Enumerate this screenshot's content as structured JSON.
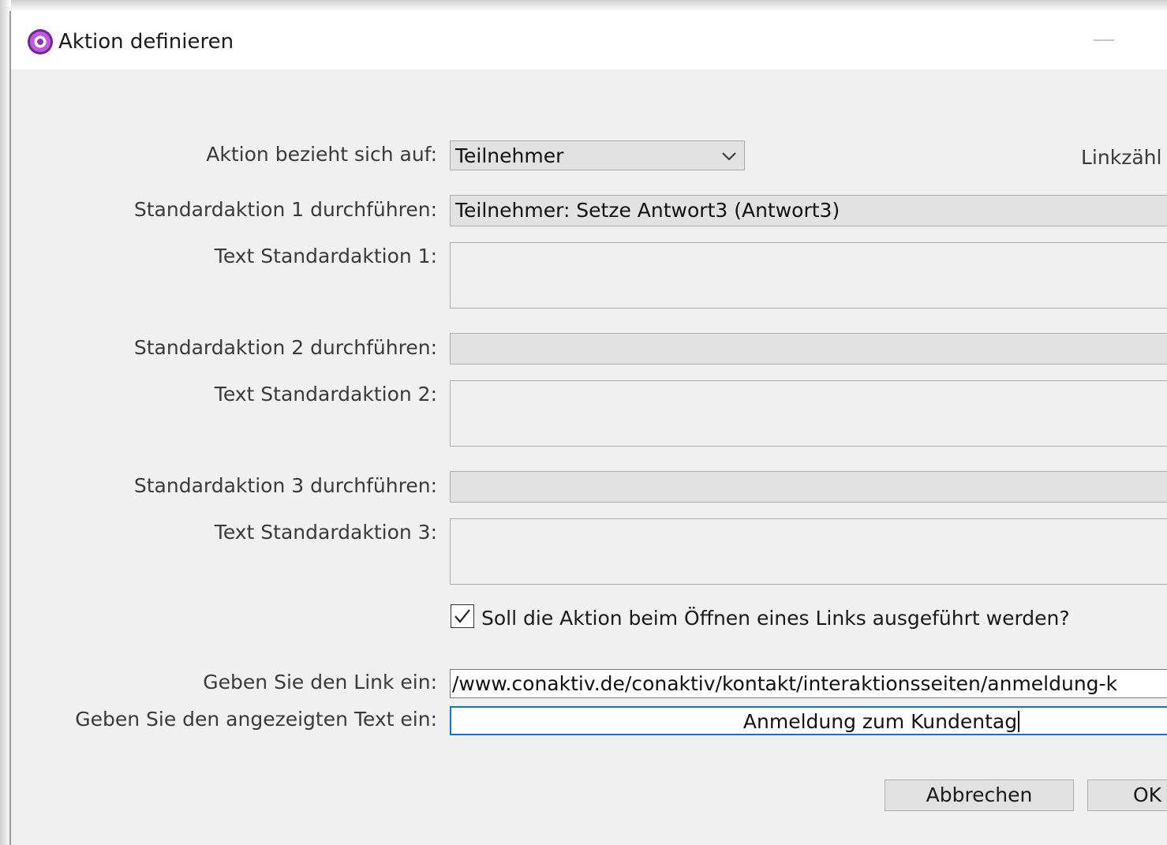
{
  "window": {
    "title": "Aktion definieren",
    "icon": "purple-ring-icon",
    "accent_color": "#0a78d7"
  },
  "form": {
    "relates_to_label": "Aktion bezieht sich auf:",
    "relates_to_value": "Teilnehmer",
    "link_counter_label": "Linkzähl",
    "action1_label": "Standardaktion 1 durchführen:",
    "action1_value": "Teilnehmer: Setze Antwort3 (Antwort3)",
    "text1_label": "Text Standardaktion 1:",
    "text1_value": "",
    "action2_label": "Standardaktion 2 durchführen:",
    "action2_value": "",
    "text2_label": "Text Standardaktion 2:",
    "text2_value": "",
    "action3_label": "Standardaktion 3 durchführen:",
    "action3_value": "",
    "text3_label": "Text Standardaktion 3:",
    "text3_value": "",
    "on_link_open_label": "Soll die Aktion beim Öffnen eines Links ausgeführt werden?",
    "on_link_open_checked": true,
    "link_label": "Geben Sie den Link ein:",
    "link_value": "/www.conaktiv.de/conaktiv/kontakt/interaktionsseiten/anmeldung-k",
    "display_text_label": "Geben Sie den angezeigten Text ein:",
    "display_text_value": "Anmeldung zum Kundentag"
  },
  "buttons": {
    "cancel": "Abbrechen",
    "ok": "OK"
  }
}
